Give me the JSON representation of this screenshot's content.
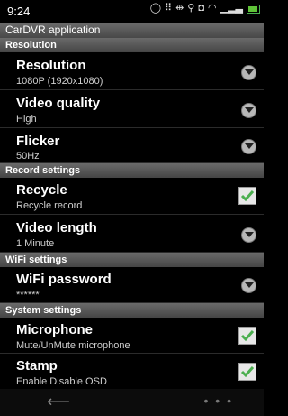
{
  "status_bar": {
    "time": "9:24"
  },
  "app": {
    "title": "CarDVR application"
  },
  "sections": {
    "resolution": "Resolution",
    "record": "Record settings",
    "wifi": "WiFi settings",
    "system": "System settings"
  },
  "settings": {
    "resolution": {
      "title": "Resolution",
      "value": "1080P (1920x1080)"
    },
    "video_quality": {
      "title": "Video quality",
      "value": "High"
    },
    "flicker": {
      "title": "Flicker",
      "value": "50Hz"
    },
    "recycle": {
      "title": "Recycle",
      "value": "Recycle record",
      "checked": true
    },
    "video_length": {
      "title": "Video length",
      "value": "1 Minute"
    },
    "wifi_password": {
      "title": "WiFi password",
      "value": "******"
    },
    "microphone": {
      "title": "Microphone",
      "value": "Mute/UnMute microphone",
      "checked": true
    },
    "stamp": {
      "title": "Stamp",
      "value": "Enable Disable OSD",
      "checked": true
    }
  },
  "icons": {
    "dropdown": "chevron-down-icon",
    "checkbox": "checkmark-icon",
    "back": "back-arrow-icon",
    "more": "more-icon"
  },
  "colors": {
    "accent_check": "#4caf50",
    "header_bg": "#555555"
  }
}
